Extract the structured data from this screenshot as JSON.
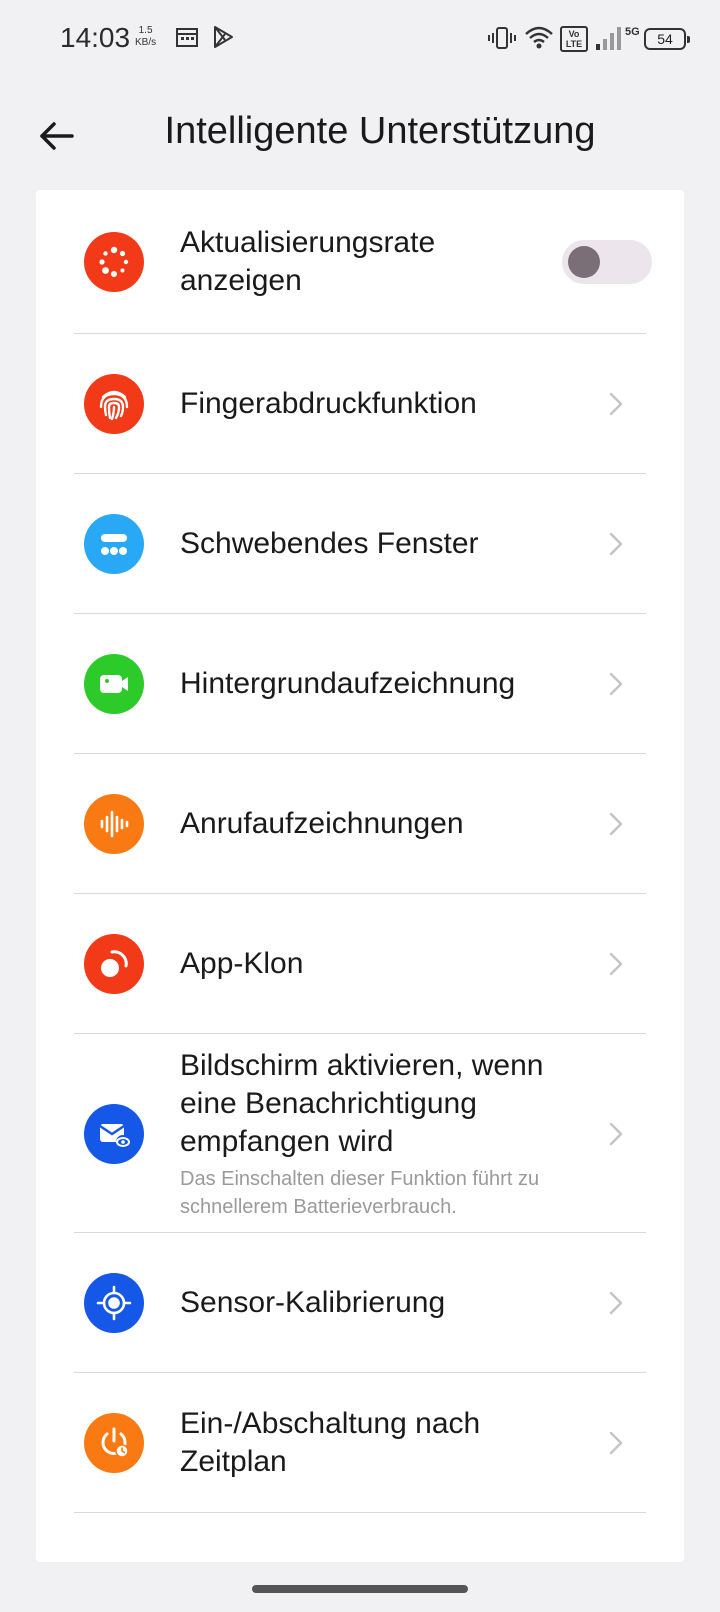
{
  "status_bar": {
    "time": "14:03",
    "net_speed_value": "1.5",
    "net_speed_unit": "KB/s",
    "volte": "Vo LTE",
    "network": "5G",
    "battery": "54"
  },
  "header": {
    "title": "Intelligente Unterstützung",
    "back_icon": "arrow-left-icon"
  },
  "settings": [
    {
      "label": "Aktualisierungsrate anzeigen",
      "icon": "refresh-rate-icon",
      "icon_color": "#f23a18",
      "control": "toggle",
      "toggle_on": false
    },
    {
      "label": "Fingerabdruckfunktion",
      "icon": "fingerprint-icon",
      "icon_color": "#f23a18",
      "control": "chevron"
    },
    {
      "label": "Schwebendes Fenster",
      "icon": "floating-window-icon",
      "icon_color": "#28a8f5",
      "control": "chevron"
    },
    {
      "label": "Hintergrundaufzeichnung",
      "icon": "video-record-icon",
      "icon_color": "#2ccb2a",
      "control": "chevron"
    },
    {
      "label": "Anrufaufzeichnungen",
      "icon": "call-recording-icon",
      "icon_color": "#f97a12",
      "control": "chevron"
    },
    {
      "label": "App-Klon",
      "icon": "app-clone-icon",
      "icon_color": "#f23a18",
      "control": "chevron"
    },
    {
      "label": "Bildschirm aktivieren, wenn eine Benachrichtigung empfangen wird",
      "sublabel": "Das Einschalten dieser Funktion führt zu schnellerem Batterieverbrauch.",
      "icon": "notification-wake-icon",
      "icon_color": "#1558e8",
      "control": "chevron"
    },
    {
      "label": "Sensor-Kalibrierung",
      "icon": "sensor-calibration-icon",
      "icon_color": "#1558e8",
      "control": "chevron"
    },
    {
      "label": "Ein-/Abschaltung nach Zeitplan",
      "icon": "scheduled-power-icon",
      "icon_color": "#f97a12",
      "control": "chevron"
    }
  ]
}
